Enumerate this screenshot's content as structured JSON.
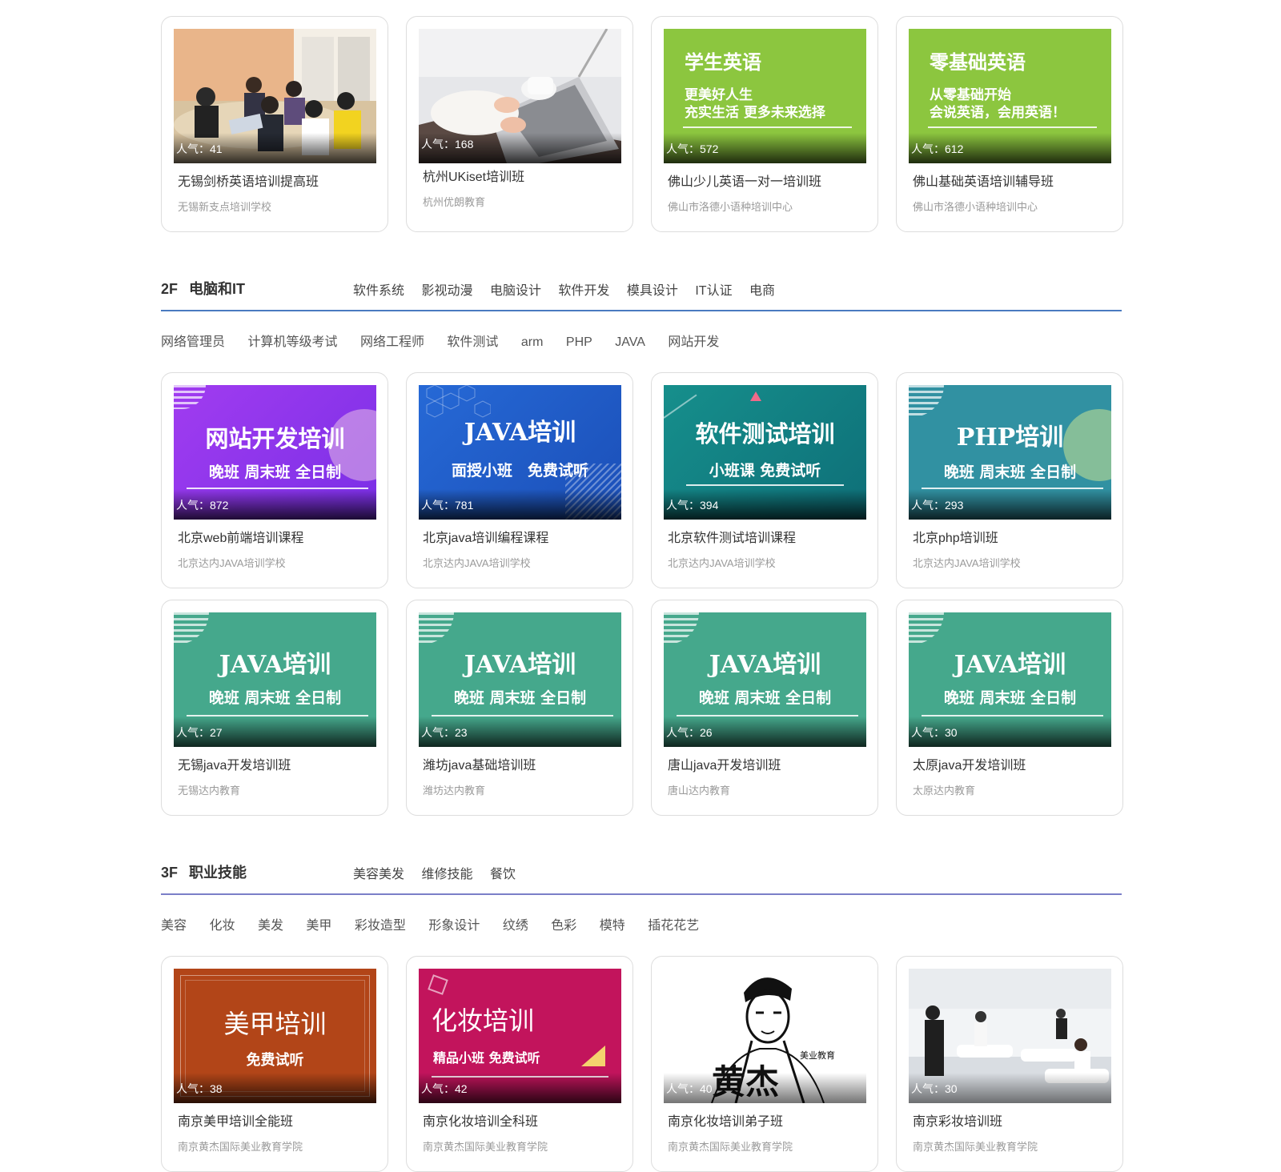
{
  "floor1_cards": [
    {
      "title": "无锡剑桥英语培训提高班",
      "school": "无锡新支点培训学校",
      "popularity": "人气：41",
      "thumb": "photo-classroom"
    },
    {
      "title": "杭州UKiset培训班",
      "school": "杭州优朗教育",
      "popularity": "人气：168",
      "thumb": "photo-laptop"
    },
    {
      "title": "佛山少儿英语一对一培训班",
      "school": "佛山市洛德小语种培训中心",
      "popularity": "人气：572",
      "thumb": "banner",
      "banner": {
        "heading": "学生英语",
        "line1": "更美好人生",
        "line2": "充实生活 更多未来选择"
      }
    },
    {
      "title": "佛山基础英语培训辅导班",
      "school": "佛山市洛德小语种培训中心",
      "popularity": "人气：612",
      "thumb": "banner",
      "banner": {
        "heading": "零基础英语",
        "line1": "从零基础开始",
        "line2": "会说英语，会用英语！"
      }
    }
  ],
  "floor2": {
    "number": "2F",
    "name": "电脑和IT",
    "tabs": [
      "软件系统",
      "影视动漫",
      "电脑设计",
      "软件开发",
      "模具设计",
      "IT认证",
      "电商"
    ],
    "subtabs": [
      "网络管理员",
      "计算机等级考试",
      "网络工程师",
      "软件测试",
      "arm",
      "PHP",
      "JAVA",
      "网站开发"
    ],
    "cards_row1": [
      {
        "title": "北京web前端培训课程",
        "school": "北京达内JAVA培训学校",
        "popularity": "人气：872",
        "banner": {
          "heading": "网站开发培训",
          "sub": "晚班 周末班 全日制"
        }
      },
      {
        "title": "北京java培训编程课程",
        "school": "北京达内JAVA培训学校",
        "popularity": "人气：781",
        "banner": {
          "heading": "JAVA培训",
          "sub": "面授小班　免费试听"
        }
      },
      {
        "title": "北京软件测试培训课程",
        "school": "北京达内JAVA培训学校",
        "popularity": "人气：394",
        "banner": {
          "heading": "软件测试培训",
          "sub": "小班课 免费试听"
        }
      },
      {
        "title": "北京php培训班",
        "school": "北京达内JAVA培训学校",
        "popularity": "人气：293",
        "banner": {
          "heading": "PHP培训",
          "sub": "晚班 周末班 全日制"
        }
      }
    ],
    "cards_row2": [
      {
        "title": "无锡java开发培训班",
        "school": "无锡达内教育",
        "popularity": "人气：27",
        "banner": {
          "heading": "JAVA培训",
          "sub": "晚班 周末班 全日制"
        }
      },
      {
        "title": "潍坊java基础培训班",
        "school": "潍坊达内教育",
        "popularity": "人气：23",
        "banner": {
          "heading": "JAVA培训",
          "sub": "晚班 周末班 全日制"
        }
      },
      {
        "title": "唐山java开发培训班",
        "school": "唐山达内教育",
        "popularity": "人气：26",
        "banner": {
          "heading": "JAVA培训",
          "sub": "晚班 周末班 全日制"
        }
      },
      {
        "title": "太原java开发培训班",
        "school": "太原达内教育",
        "popularity": "人气：30",
        "banner": {
          "heading": "JAVA培训",
          "sub": "晚班 周末班 全日制"
        }
      }
    ]
  },
  "floor3": {
    "number": "3F",
    "name": "职业技能",
    "tabs": [
      "美容美发",
      "维修技能",
      "餐饮"
    ],
    "subtabs": [
      "美容",
      "化妆",
      "美发",
      "美甲",
      "彩妆造型",
      "形象设计",
      "纹绣",
      "色彩",
      "模特",
      "插花花艺"
    ],
    "cards": [
      {
        "title": "南京美甲培训全能班",
        "school": "南京黄杰国际美业教育学院",
        "popularity": "人气：38",
        "banner": {
          "heading": "美甲培训",
          "sub": "免费试听"
        }
      },
      {
        "title": "南京化妆培训全科班",
        "school": "南京黄杰国际美业教育学院",
        "popularity": "人气：42",
        "banner": {
          "heading": "化妆培训",
          "sub": "精品小班 免费试听"
        }
      },
      {
        "title": "南京化妆培训弟子班",
        "school": "南京黄杰国际美业教育学院",
        "popularity": "人气：40",
        "banner": {
          "heading": "黄杰",
          "sub": "美业教育"
        }
      },
      {
        "title": "南京彩妆培训班",
        "school": "南京黄杰国际美业教育学院",
        "popularity": "人气：30",
        "thumb": "photo-salon"
      }
    ]
  },
  "colors": {
    "floor2_line": "#4a7ac0",
    "floor3_line": "#7b7fc8",
    "english_green": "#8cc63f",
    "java_teal": "#45a88c",
    "web_purple": "#8a3df0",
    "java_blue": "#1f5cc8",
    "test_teal": "#14858a",
    "php_teal": "#3191a2",
    "nail_orange": "#b24518",
    "makeup_magenta": "#c2145c"
  }
}
